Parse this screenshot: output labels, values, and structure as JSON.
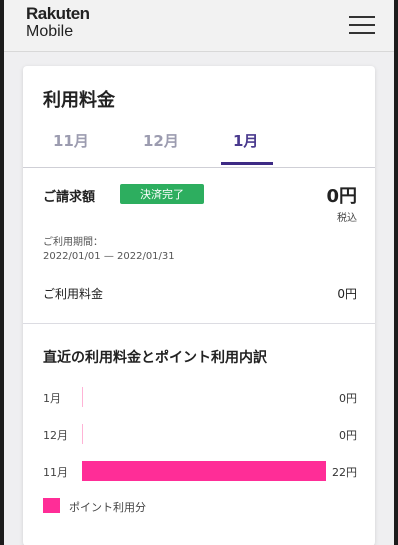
{
  "header": {
    "logo_line1": "Rakuten",
    "logo_line2": "Mobile",
    "menu_icon": "hamburger-menu-icon"
  },
  "card": {
    "title": "利用料金",
    "tabs": [
      {
        "label": "11月",
        "active": false
      },
      {
        "label": "12月",
        "active": false
      },
      {
        "label": "1月",
        "active": true
      }
    ],
    "billing": {
      "label": "ご請求額",
      "status_badge": "決済完了",
      "amount": "0円",
      "tax_note": "税込",
      "period_label": "ご利用期間：",
      "period_value": "2022/01/01 — 2022/01/31",
      "usage_label": "ご利用料金",
      "usage_value": "0円"
    },
    "breakdown": {
      "title": "直近の利用料金とポイント利用内訳",
      "rows": [
        {
          "month": "1月",
          "value": "0円",
          "fraction": 0
        },
        {
          "month": "12月",
          "value": "0円",
          "fraction": 0
        },
        {
          "month": "11月",
          "value": "22円",
          "fraction": 1
        }
      ],
      "legend": "ポイント利用分"
    }
  },
  "colors": {
    "accent": "#3d2a84",
    "badge_green": "#2dae5f",
    "bar_pink": "#ff2d97"
  }
}
